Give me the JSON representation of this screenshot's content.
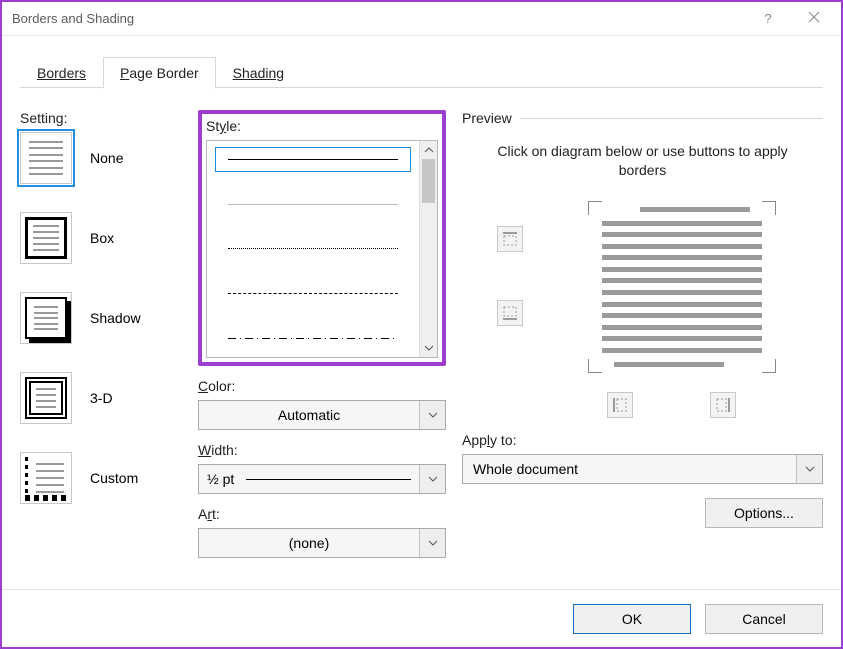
{
  "window": {
    "title": "Borders and Shading"
  },
  "tabs": {
    "borders": "Borders",
    "page_border": "Page Border",
    "shading": "Shading",
    "active": "page_border"
  },
  "setting": {
    "label": "Setting:",
    "items": [
      {
        "key": "none",
        "label": "None"
      },
      {
        "key": "box",
        "label": "Box"
      },
      {
        "key": "shadow",
        "label": "Shadow"
      },
      {
        "key": "3d",
        "label": "3-D"
      },
      {
        "key": "custom",
        "label": "Custom"
      }
    ],
    "selected": "none"
  },
  "style": {
    "label": "Style:",
    "color_label": "Color:",
    "color_value": "Automatic",
    "width_label": "Width:",
    "width_value": "½ pt",
    "art_label": "Art:",
    "art_value": "(none)"
  },
  "preview": {
    "label": "Preview",
    "hint": "Click on diagram below or use buttons to apply borders",
    "apply_label": "Apply to:",
    "apply_value": "Whole document",
    "options_label": "Options..."
  },
  "footer": {
    "ok": "OK",
    "cancel": "Cancel"
  }
}
